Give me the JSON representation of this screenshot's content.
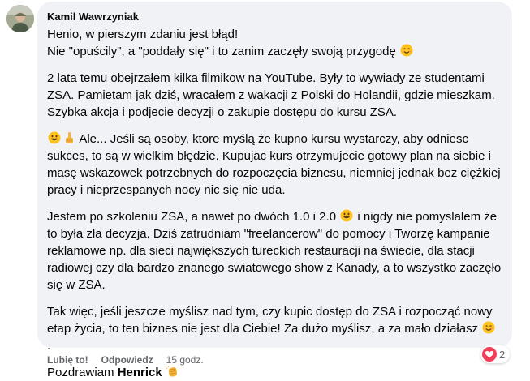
{
  "comment": {
    "author": "Kamil Wawrzyniak",
    "paragraphs": {
      "p1_line1": "Henio, w pierszym zdaniu jest błąd!",
      "p1_line2": "Nie \"opuścily\", a \"poddały się\" i to zanim zaczęły swoją przygodę",
      "p2": "2 lata temu obejrzałem kilka filmikow na YouTube. Były to wywiady ze studentami ZSA. Pamietam jak dziś, wracałem z wakacji z Polski do Holandii, gdzie mieszkam. Szybka akcja i podjecie decyzji o zakupie dostępu do kursu ZSA.",
      "p3": " Ale... Jeśli są osoby, ktore myślą że kupno kursu wystarczy, aby odniesc sukces, to są w wielkim błędzie. Kupujac kurs otrzymujecie gotowy plan na siebie i masę wskazowek potrzebnych do rozpoczęcia biznesu, niemniej jednak bez ciężkiej pracy i nieprzespanych nocy nic się nie uda.",
      "p4_part1": "Jestem po szkoleniu ZSA, a nawet po dwóch 1.0 i 2.0 ",
      "p4_part2": " i nigdy nie pomyslalem że to była zła decyzja. Dziś zatrudniam \"freelancerow\" do pomocy i Tworzę kampanie reklamowe np. dla sieci największych tureckich restauracji na świecie, dla stacji radiowej czy dla bardzo znanego swiatowego show z Kanady, a to wszystko zaczęło się w ZSA.",
      "p5": "Tak więc, jeśli jeszcze myślisz nad tym, czy kupic dostęp do ZSA i rozpocząć nowy etap życia, to ten biznes nie jest dla Ciebie! Za dużo myślisz, a za mało działasz ",
      "p5_end": " .",
      "p6_prefix": "Pozdrawiam ",
      "p6_name": "Henrick"
    },
    "emojis": [
      "smiling-face-icon",
      "grinning-face-icon",
      "pointing-up-icon",
      "clapping-hands-icon"
    ]
  },
  "actions": {
    "like": "Lubię to!",
    "reply": "Odpowiedz",
    "time": "15 godz."
  },
  "reactions": {
    "count": "2",
    "type": "heart-icon",
    "color": "#f33e58"
  },
  "colors": {
    "bubble": "#f0f2f5",
    "secondary_text": "#65676b"
  }
}
